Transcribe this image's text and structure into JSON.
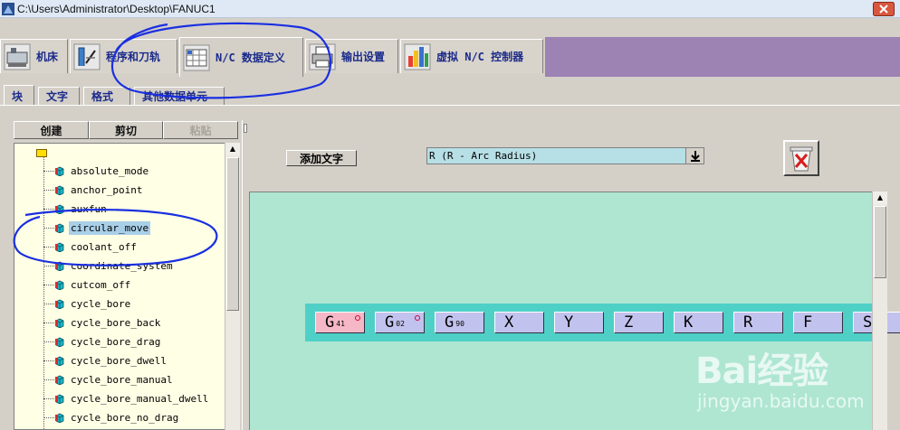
{
  "window": {
    "title": "C:\\Users\\Administrator\\Desktop\\FANUC1"
  },
  "main_tabs": [
    {
      "label": "机床",
      "icon": "machine-icon"
    },
    {
      "label": "程序和刀轨",
      "icon": "program-toolpath-icon"
    },
    {
      "label": "N/C 数据定义",
      "icon": "nc-data-icon",
      "active": true
    },
    {
      "label": "输出设置",
      "icon": "printer-icon"
    },
    {
      "label": "虚拟 N/C 控制器",
      "icon": "virtual-controller-icon"
    }
  ],
  "sub_tabs": [
    {
      "label": "块",
      "active": true
    },
    {
      "label": "文字"
    },
    {
      "label": "格式"
    },
    {
      "label": "其他数据单元"
    }
  ],
  "actions": {
    "create": "创建",
    "cut": "剪切",
    "paste": "粘贴"
  },
  "tree": {
    "items": [
      "absolute_mode",
      "anchor_point",
      "auxfun",
      "circular_move",
      "coolant_off",
      "coordinate_system",
      "cutcom_off",
      "cycle_bore",
      "cycle_bore_back",
      "cycle_bore_drag",
      "cycle_bore_dwell",
      "cycle_bore_manual",
      "cycle_bore_manual_dwell",
      "cycle_bore_no_drag"
    ],
    "selected": "circular_move"
  },
  "block_editor": {
    "add_text_label": "添加文字",
    "word_select_value": "R (R - Arc Radius)"
  },
  "block_words": [
    {
      "letter": "G",
      "sub": "41",
      "modal": true,
      "marked": true
    },
    {
      "letter": "G",
      "sub": "02",
      "modal": false,
      "marked": true
    },
    {
      "letter": "G",
      "sub": "90",
      "modal": false,
      "marked": false
    },
    {
      "letter": "X",
      "sub": "",
      "modal": false,
      "marked": false
    },
    {
      "letter": "Y",
      "sub": "",
      "modal": false,
      "marked": false
    },
    {
      "letter": "Z",
      "sub": "",
      "modal": false,
      "marked": false
    },
    {
      "letter": "K",
      "sub": "",
      "modal": false,
      "marked": false
    },
    {
      "letter": "R",
      "sub": "",
      "modal": false,
      "marked": false
    },
    {
      "letter": "F",
      "sub": "",
      "modal": false,
      "marked": false
    },
    {
      "letter": "S",
      "sub": "",
      "modal": false,
      "marked": false
    }
  ],
  "watermark": {
    "brand": "Bai经验",
    "url": "jingyan.baidu.com"
  },
  "colors": {
    "tab_fill": "#9d82b4",
    "tab_label": "#1b2a8a",
    "tree_bg": "#ffffe6",
    "canvas_bg": "#aee6d2",
    "block_bar": "#4fd0c7",
    "word_bg": "#c2c2ee",
    "modal_word_bg": "#f6b8c7",
    "annotation": "#1a2fe0"
  }
}
